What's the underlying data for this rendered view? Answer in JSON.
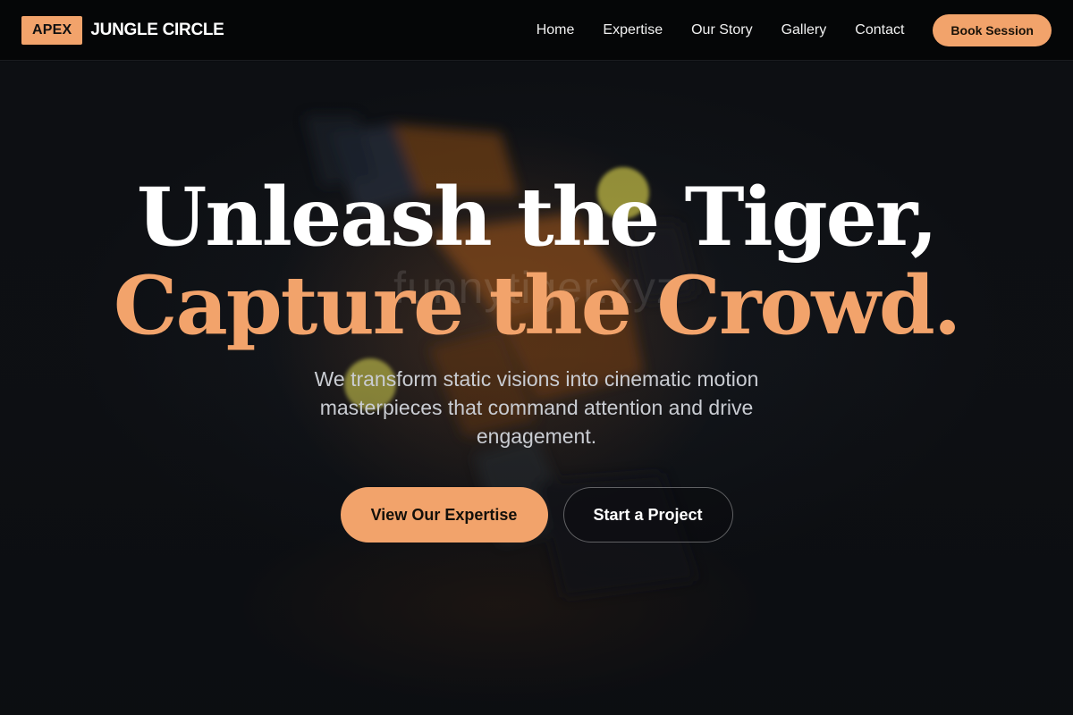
{
  "brand": {
    "badge": "APEX",
    "name": "JUNGLE CIRCLE"
  },
  "nav": {
    "links": [
      "Home",
      "Expertise",
      "Our Story",
      "Gallery",
      "Contact"
    ],
    "cta": "Book Session"
  },
  "hero": {
    "headline_line1": "Unleash the Tiger,",
    "headline_line2": "Capture the Crowd.",
    "subtext": "We transform static visions into cinematic motion masterpieces that command attention and drive engagement.",
    "watermark": "funnytiger.xyz",
    "primary_cta": "View Our Expertise",
    "secondary_cta": "Start a Project"
  },
  "colors": {
    "accent": "#f2a36b",
    "header_bg": "#050607",
    "hero_bg": "#0e1014",
    "bokeh": "#c9c24a"
  }
}
